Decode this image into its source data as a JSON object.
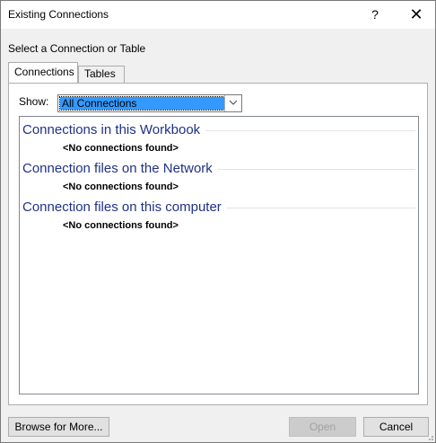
{
  "window": {
    "title": "Existing Connections",
    "help_glyph": "?",
    "close_glyph": "✕"
  },
  "dialog": {
    "prompt": "Select a Connection or Table"
  },
  "tabs": [
    {
      "label": "Connections",
      "active": true
    },
    {
      "label": "Tables",
      "active": false
    }
  ],
  "filter": {
    "label": "Show:",
    "selected": "All Connections"
  },
  "groups": [
    {
      "title": "Connections in this Workbook",
      "empty_text": "<No connections found>"
    },
    {
      "title": "Connection files on the Network",
      "empty_text": "<No connections found>"
    },
    {
      "title": "Connection files on this computer",
      "empty_text": "<No connections found>"
    }
  ],
  "buttons": {
    "browse": "Browse for More...",
    "open": "Open",
    "cancel": "Cancel"
  },
  "colors": {
    "group_title": "#1e3287",
    "selection": "#3399ff"
  }
}
